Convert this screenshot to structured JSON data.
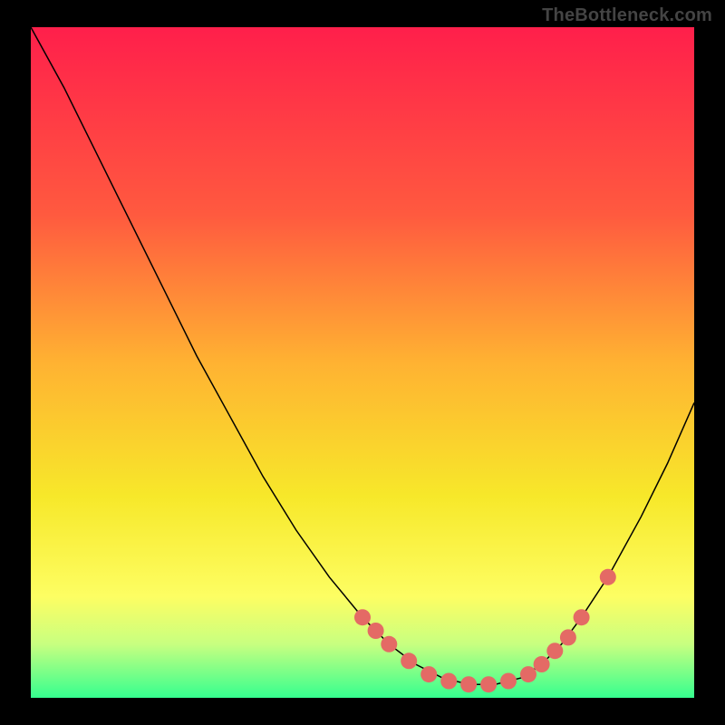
{
  "watermark": "TheBottleneck.com",
  "chart_data": {
    "type": "line",
    "title": "",
    "xlabel": "",
    "ylabel": "",
    "xlim": [
      0,
      1
    ],
    "ylim": [
      0,
      1
    ],
    "grid": false,
    "legend": false,
    "background_gradient": {
      "orientation": "vertical",
      "stops": [
        {
          "offset": 0.0,
          "color": "#ff1f4b"
        },
        {
          "offset": 0.28,
          "color": "#ff5a3f"
        },
        {
          "offset": 0.5,
          "color": "#ffb232"
        },
        {
          "offset": 0.7,
          "color": "#f7e82a"
        },
        {
          "offset": 0.85,
          "color": "#fdfe63"
        },
        {
          "offset": 0.92,
          "color": "#c8ff80"
        },
        {
          "offset": 1.0,
          "color": "#35ff8f"
        }
      ]
    },
    "series": [
      {
        "name": "curve",
        "color": "#000000",
        "width": 1.5,
        "x": [
          0.0,
          0.05,
          0.1,
          0.15,
          0.2,
          0.25,
          0.3,
          0.35,
          0.4,
          0.45,
          0.5,
          0.54,
          0.58,
          0.62,
          0.66,
          0.7,
          0.74,
          0.77,
          0.8,
          0.83,
          0.87,
          0.92,
          0.96,
          1.0
        ],
        "y": [
          1.0,
          0.91,
          0.81,
          0.71,
          0.61,
          0.51,
          0.42,
          0.33,
          0.25,
          0.18,
          0.12,
          0.08,
          0.05,
          0.03,
          0.02,
          0.02,
          0.03,
          0.05,
          0.08,
          0.12,
          0.18,
          0.27,
          0.35,
          0.44
        ]
      }
    ],
    "markers": {
      "name": "dots",
      "color": "#e46a65",
      "radius": 9,
      "x": [
        0.5,
        0.52,
        0.54,
        0.57,
        0.6,
        0.63,
        0.66,
        0.69,
        0.72,
        0.75,
        0.77,
        0.79,
        0.81,
        0.83,
        0.87
      ],
      "y": [
        0.12,
        0.1,
        0.08,
        0.055,
        0.035,
        0.025,
        0.02,
        0.02,
        0.025,
        0.035,
        0.05,
        0.07,
        0.09,
        0.12,
        0.18
      ]
    }
  }
}
